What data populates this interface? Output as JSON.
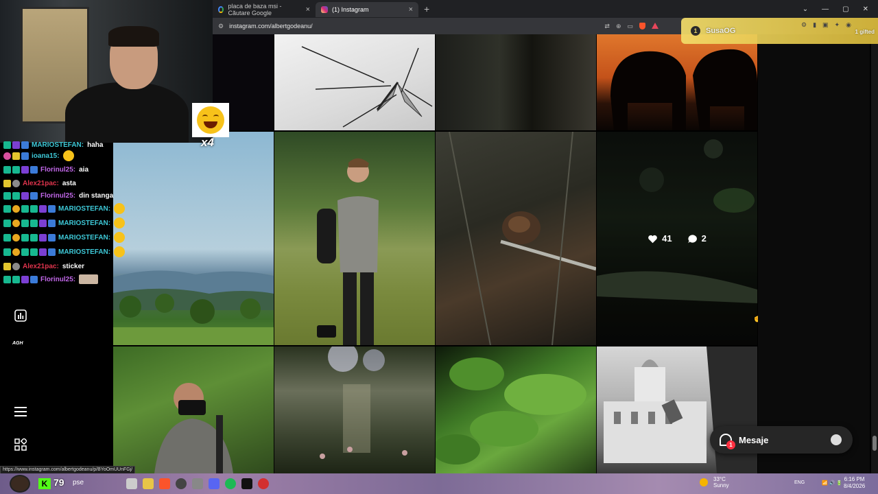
{
  "browser": {
    "tabs": [
      {
        "label": "placa de baza msi - Căutare Google",
        "active": false
      },
      {
        "label": "(1) Instagram",
        "active": true
      }
    ],
    "url": "instagram.com/albertgodeanu/",
    "status_url": "https://www.instagram.com/albertgodeanu/p/BYoOmUUnFGj/"
  },
  "instagram": {
    "hovered_post": {
      "likes": "41",
      "comments": "2"
    },
    "mesaje": {
      "label": "Mesaje",
      "badge": "1"
    }
  },
  "stream": {
    "emote_multiplier": "x4",
    "viewers": "79",
    "viewers_suffix": "pse",
    "gift": {
      "username": "SusaOG",
      "label": "1 gifted"
    },
    "chat": [
      {
        "user": "MARIOSTEFAN:",
        "msg": "haha",
        "color": "#3ec9d8"
      },
      {
        "user": "ioana15:",
        "msg": "",
        "emote": true,
        "color": "#3ec9d8"
      },
      {
        "user": "Florinul25:",
        "msg": "aia",
        "color": "#c167e8"
      },
      {
        "user": "Alex21pac:",
        "msg": "asta",
        "color": "#e0344d"
      },
      {
        "user": "Florinul25:",
        "msg": "din stanga",
        "color": "#c167e8"
      },
      {
        "user": "MARIOSTEFAN:",
        "msg": "",
        "emote": true,
        "color": "#3ec9d8"
      },
      {
        "user": "MARIOSTEFAN:",
        "msg": "",
        "emote": true,
        "color": "#3ec9d8"
      },
      {
        "user": "MARIOSTEFAN:",
        "msg": "",
        "emote": true,
        "color": "#3ec9d8"
      },
      {
        "user": "MARIOSTEFAN:",
        "msg": "",
        "emote": true,
        "color": "#3ec9d8"
      },
      {
        "user": "Alex21pac:",
        "msg": "sticker",
        "color": "#e0344d"
      },
      {
        "user": "Florinul25:",
        "msg": "",
        "image": true,
        "color": "#c167e8"
      }
    ]
  },
  "taskbar": {
    "weather": {
      "temp": "33°C",
      "condition": "Sunny"
    },
    "lang": "ENG",
    "time": "6:16 PM",
    "date": "8/4/2026"
  },
  "icons": {
    "leftbar": [
      "stats-icon",
      "agh-logo",
      "menu-icon",
      "grid-icon"
    ]
  }
}
